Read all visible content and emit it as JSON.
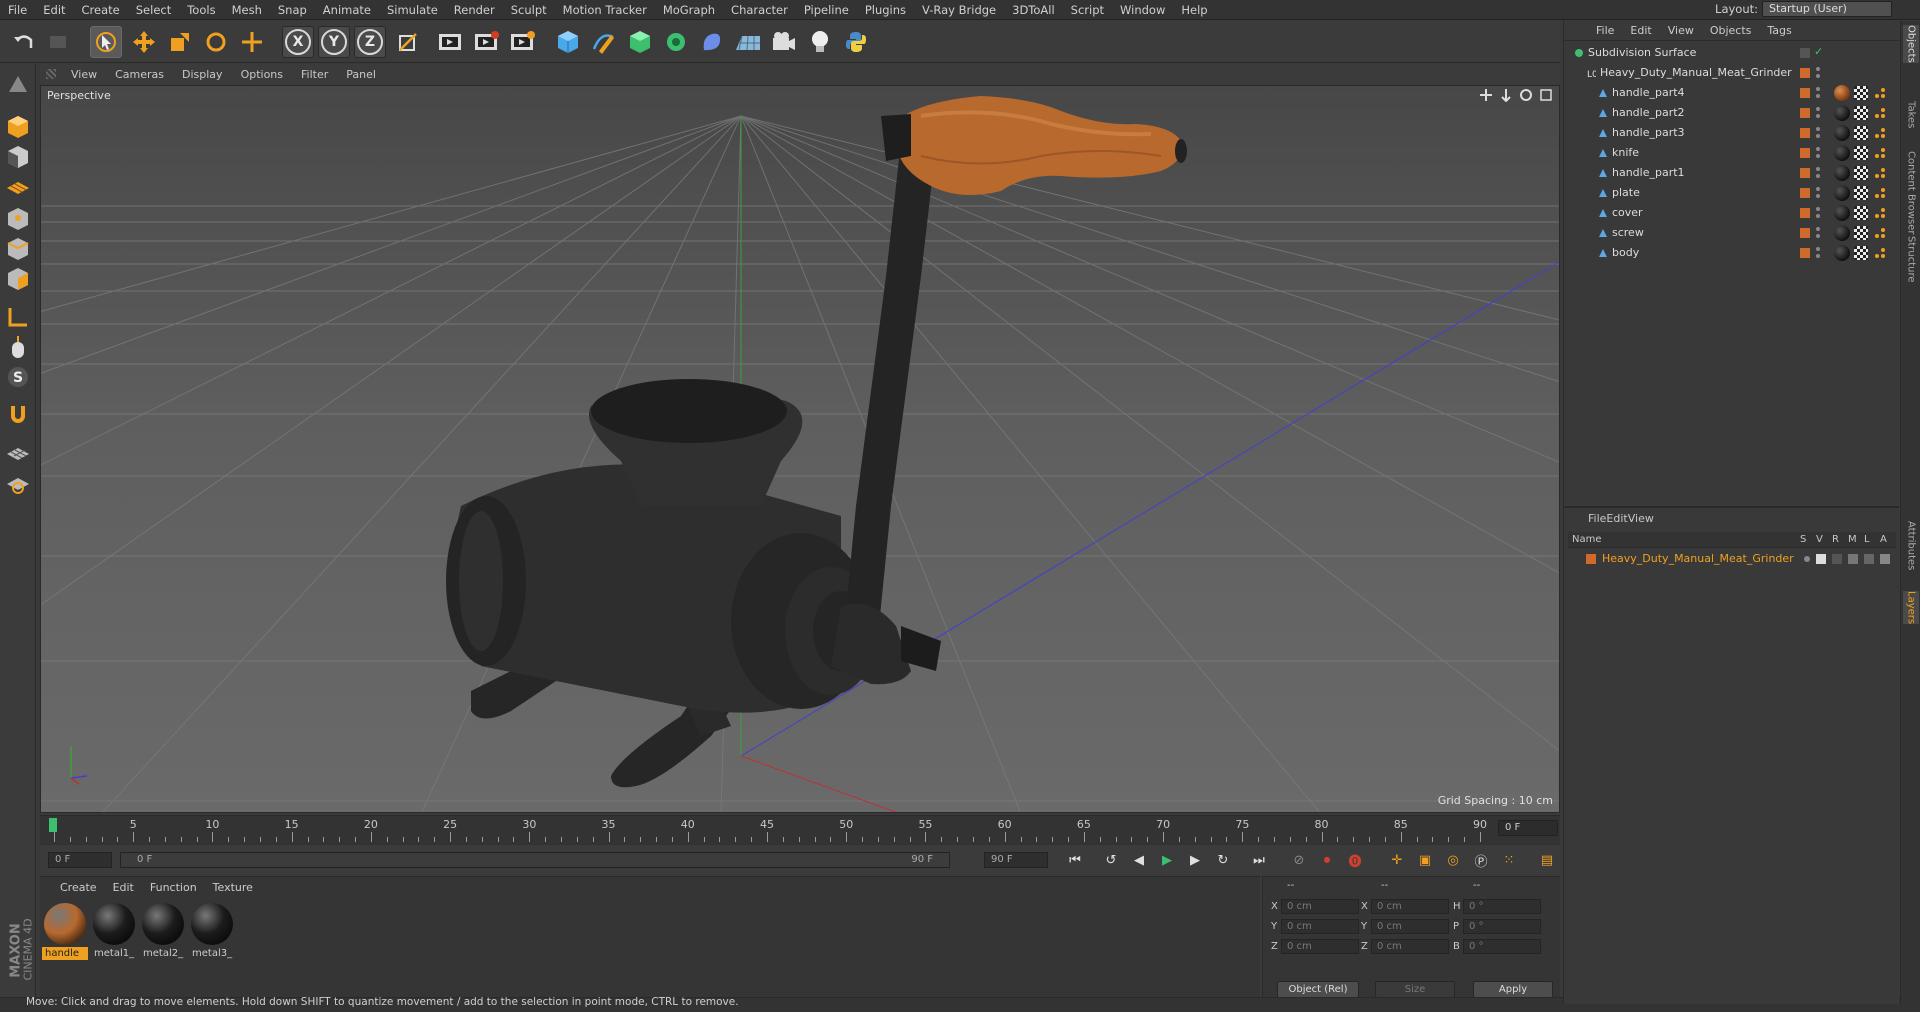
{
  "menu": [
    "File",
    "Edit",
    "Create",
    "Select",
    "Tools",
    "Mesh",
    "Snap",
    "Animate",
    "Simulate",
    "Render",
    "Sculpt",
    "Motion Tracker",
    "MoGraph",
    "Character",
    "Pipeline",
    "Plugins",
    "V-Ray Bridge",
    "3DToAll",
    "Script",
    "Window",
    "Help"
  ],
  "layout": {
    "label": "Layout:",
    "value": "Startup (User)"
  },
  "toolbar": {
    "x_label": "X",
    "y_label": "Y",
    "z_label": "Z"
  },
  "viewport": {
    "menu": [
      "View",
      "Cameras",
      "Display",
      "Options",
      "Filter",
      "Panel"
    ],
    "camera_label": "Perspective",
    "grid_spacing": "Grid Spacing : 10 cm"
  },
  "timeline": {
    "ticks": [
      "0",
      "5",
      "10",
      "15",
      "20",
      "25",
      "30",
      "35",
      "40",
      "45",
      "50",
      "55",
      "60",
      "65",
      "70",
      "75",
      "80",
      "85",
      "90"
    ],
    "current_frame_right": "0 F",
    "start_field": "0 F",
    "range_start": "0 F",
    "range_end": "90 F",
    "end_field": "90 F"
  },
  "materials": {
    "menu": [
      "Create",
      "Edit",
      "Function",
      "Texture"
    ],
    "items": [
      {
        "label": "handle",
        "color": "#b8692e"
      },
      {
        "label": "metal1_",
        "color": "#1c1c1c"
      },
      {
        "label": "metal2_",
        "color": "#1c1c1c"
      },
      {
        "label": "metal3_",
        "color": "#1c1c1c"
      }
    ]
  },
  "coordinates": {
    "headers": [
      "--",
      "--",
      "--"
    ],
    "rows": [
      {
        "a": "X",
        "av": "0 cm",
        "b": "X",
        "bv": "0 cm",
        "c": "H",
        "cv": "0 °"
      },
      {
        "a": "Y",
        "av": "0 cm",
        "b": "Y",
        "bv": "0 cm",
        "c": "P",
        "cv": "0 °"
      },
      {
        "a": "Z",
        "av": "0 cm",
        "b": "Z",
        "bv": "0 cm",
        "c": "B",
        "cv": "0 °"
      }
    ],
    "mode": "Object (Rel)",
    "size": "Size",
    "apply": "Apply"
  },
  "objects": {
    "menu": [
      "File",
      "Edit",
      "View",
      "Objects",
      "Tags"
    ],
    "root": "Subdivision Surface",
    "group": "Heavy_Duty_Manual_Meat_Grinder",
    "children": [
      "handle_part4",
      "handle_part2",
      "handle_part3",
      "knife",
      "handle_part1",
      "plate",
      "cover",
      "screw",
      "body"
    ]
  },
  "layers": {
    "menu": [
      "File",
      "Edit",
      "View"
    ],
    "columns": {
      "name": "Name",
      "s": "S",
      "v": "V",
      "r": "R",
      "m": "M",
      "l": "L",
      "a": "A"
    },
    "items": [
      "Heavy_Duty_Manual_Meat_Grinder"
    ]
  },
  "side_tabs": [
    "Objects",
    "Takes",
    "Content Browser",
    "Structure",
    "Attributes",
    "Layers"
  ],
  "brand": {
    "maxon": "MAXON",
    "product": "CINEMA 4D"
  },
  "status": "Move: Click and drag to move elements. Hold down SHIFT to quantize movement / add to the selection in point mode, CTRL to remove.",
  "colors": {
    "accent": "#f0a020",
    "object_orange": "#d06a2a",
    "wood": "#b8692e"
  }
}
